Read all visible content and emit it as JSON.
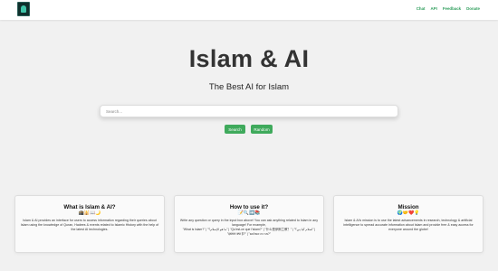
{
  "nav": {
    "links": [
      "Chat",
      "API",
      "Feedback",
      "Donate"
    ]
  },
  "hero": {
    "title": "Islam & AI",
    "subtitle": "The Best AI for Islam"
  },
  "search": {
    "placeholder": "Search...",
    "value": ""
  },
  "buttons": {
    "search_label": "Search",
    "random_label": "Random"
  },
  "cards": [
    {
      "title": "What is Islam & AI?",
      "emojis": "🕋🕌📖🌙",
      "body": "Islam & AI provides an interface for users to access information regarding their queries about Islam using the knowledge of Quran, Hadees & events related to Islamic History with the help of the latest AI technologies."
    },
    {
      "title": "How to use it?",
      "emojis": "📝🔍➡️📚",
      "body": "Write any question or query in the input box above! You can ask anything related to Islam in any language! For example,",
      "examples": "\"What is Islam?\" | \"ما هو الإسلام؟\" | \"Qu'est-ce que l'islam?\" | \"什么是伊斯兰教？\" | \"اسلام کیا ہے؟\" | \"इस्लाम क्या है?\" | \"מה זה אסלאם?\""
    },
    {
      "title": "Mission",
      "emojis": "🌍🤝❤️💡",
      "body": "Islam & AI's mission is to use the latest advancements in research, technology & artificial intelligence to spread accurate information about Islam and provide free & easy access for everyone around the globe!"
    }
  ],
  "colors": {
    "accent": "#3faa5c",
    "nav_link": "#2f9e5c",
    "background": "#f1f1f1",
    "logo_bg": "#0f2f2c"
  }
}
